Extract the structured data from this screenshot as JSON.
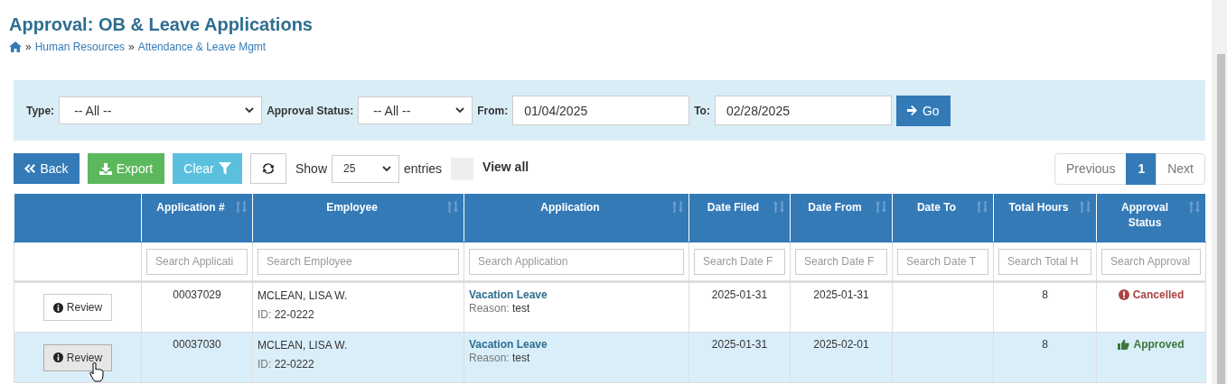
{
  "page_title": "Approval: OB & Leave Applications",
  "breadcrumb": [
    {
      "separator": "»",
      "label": "Human Resources"
    },
    {
      "separator": "»",
      "label": "Attendance & Leave Mgmt"
    }
  ],
  "filters": {
    "type": {
      "label": "Type:",
      "value": "-- All --"
    },
    "approval_status": {
      "label": "Approval Status:",
      "value": "-- All --"
    },
    "from": {
      "label": "From:",
      "value": "01/04/2025"
    },
    "to": {
      "label": "To:",
      "value": "02/28/2025"
    },
    "go_button": "Go"
  },
  "toolbar": {
    "back_button": "Back",
    "export_button": "Export",
    "clear_button": "Clear",
    "show_label": "Show",
    "page_size": "25",
    "entries_label": "entries",
    "view_all": {
      "label": "View all",
      "checked": false
    }
  },
  "pagination": [
    {
      "label": "Previous",
      "kind": "prev",
      "selected": false
    },
    {
      "label": "1",
      "kind": "page",
      "selected": true
    },
    {
      "label": "Next",
      "kind": "next",
      "selected": false
    }
  ],
  "table": {
    "columns": [
      {
        "sortable": false
      },
      {
        "label": "Application #",
        "sortable": true,
        "placeholder": "Search Applicati"
      },
      {
        "label": "Employee",
        "sortable": true,
        "placeholder": "Search Employee"
      },
      {
        "label": "Application",
        "sortable": true,
        "placeholder": "Search Application"
      },
      {
        "label": "Date Filed",
        "sortable": true,
        "placeholder": "Search Date F"
      },
      {
        "label": "Date From",
        "sortable": true,
        "placeholder": "Search Date F"
      },
      {
        "label": "Date To",
        "sortable": true,
        "placeholder": "Search Date T"
      },
      {
        "label": "Total Hours",
        "sortable": true,
        "placeholder": "Search Total H"
      },
      {
        "label": "Approval Status",
        "sortable": true,
        "placeholder": "Search Approval"
      }
    ],
    "rows": [
      {
        "action": "Review",
        "application_no": "00037029",
        "employee": "MCLEAN, LISA W.",
        "id_label": "ID:",
        "id": "22-0222",
        "application": "Vacation Leave",
        "reason_label": "Reason:",
        "reason": "test",
        "date_filed": "2025-01-31",
        "date_from": "2025-01-31",
        "total_hours": "8",
        "status": {
          "label": "Cancelled",
          "kind": "cancelled"
        },
        "highlighted": false
      },
      {
        "action": "Review",
        "application_no": "00037030",
        "employee": "MCLEAN, LISA W.",
        "id_label": "ID:",
        "id": "22-0222",
        "application": "Vacation Leave",
        "reason_label": "Reason:",
        "reason": "test",
        "date_filed": "2025-01-31",
        "date_from": "2025-02-01",
        "total_hours": "8",
        "status": {
          "label": "Approved",
          "kind": "approved"
        },
        "highlighted": true
      }
    ]
  }
}
